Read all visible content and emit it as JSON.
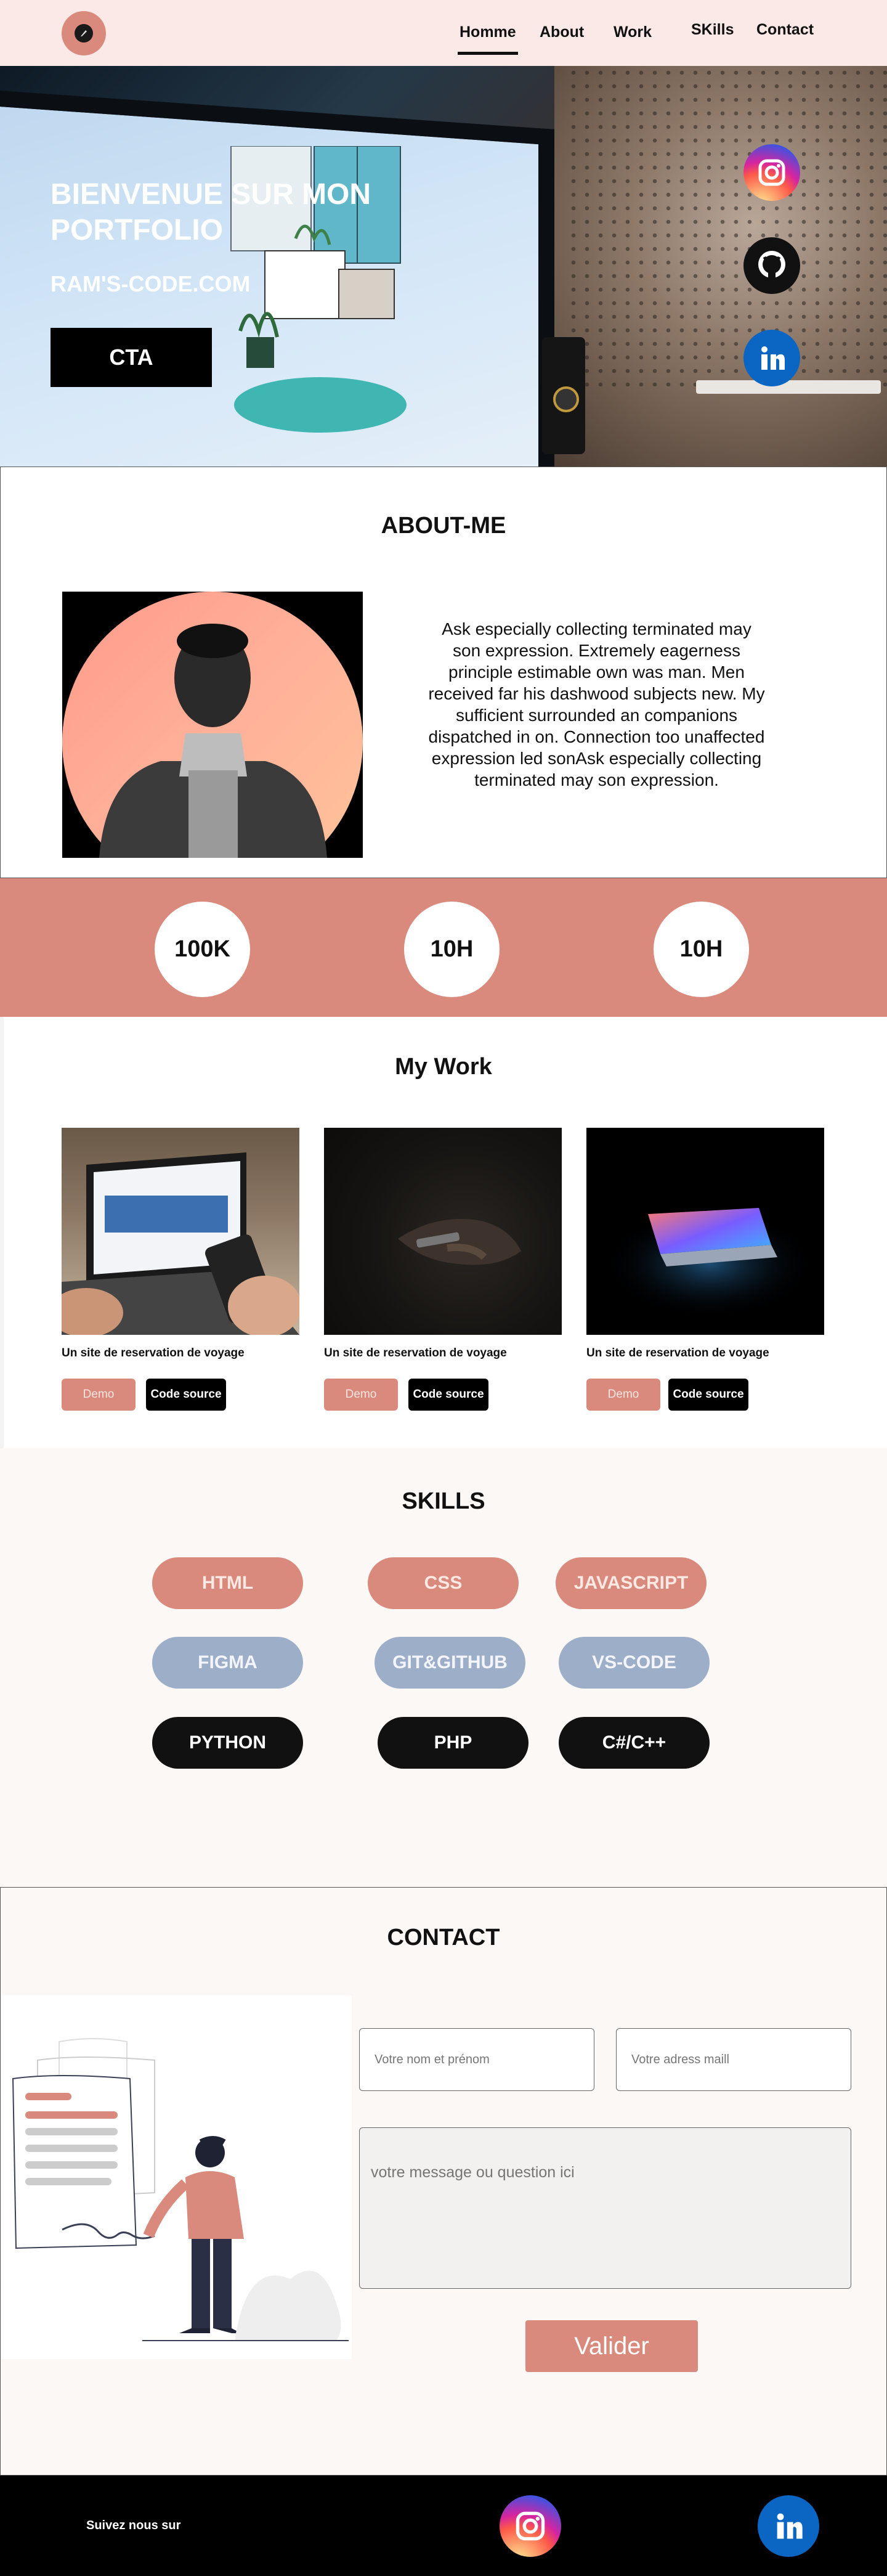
{
  "nav": {
    "logo_icon": "pen-nib-icon",
    "links": [
      {
        "label": "Homme",
        "active": true
      },
      {
        "label": "About"
      },
      {
        "label": "Work"
      },
      {
        "label": "SKills"
      },
      {
        "label": "Contact"
      }
    ]
  },
  "hero": {
    "title": "BIENVENUE SUR MON PORTFOLIO",
    "subtitle": "RAM'S-CODE.COM",
    "cta_label": "CTA",
    "socials": [
      "instagram-icon",
      "github-icon",
      "linkedin-icon"
    ]
  },
  "about": {
    "title": "ABOUT-ME",
    "text": "Ask especially collecting terminated may son expression. Extremely eagerness principle estimable own was man. Men received far his dashwood subjects new. My sufficient surrounded an companions dispatched in on. Connection too unaffected expression led sonAsk especially collecting terminated may son expression."
  },
  "stats": [
    "100K",
    "10H",
    "10H"
  ],
  "work": {
    "title": "My Work",
    "cards": [
      {
        "title": "Un site de reservation de voyage",
        "demo": "Demo",
        "source": "Code source"
      },
      {
        "title": "Un site de reservation de voyage",
        "demo": "Demo",
        "source": "Code source"
      },
      {
        "title": "Un site de reservation de voyage",
        "demo": "Demo",
        "source": "Code source"
      }
    ]
  },
  "skills": {
    "title": "SKILLS",
    "items": [
      "HTML",
      "CSS",
      "JAVASCRIPT",
      "FIGMA",
      "GIT&GITHUB",
      "VS-CODE",
      "PYTHON",
      "PHP",
      "C#/C++"
    ]
  },
  "contact": {
    "title": "CONTACT",
    "name_placeholder": "Votre nom et prénom",
    "email_placeholder": "Votre adress maill",
    "message_placeholder": "votre message ou question ici",
    "submit_label": "Valider"
  },
  "footer": {
    "text": "Suivez nous sur",
    "socials": [
      "instagram-icon",
      "linkedin-icon"
    ]
  },
  "colors": {
    "accent": "#d98a7c",
    "nav_bg": "#fbe9e8",
    "skill_blue": "#9daec8"
  }
}
